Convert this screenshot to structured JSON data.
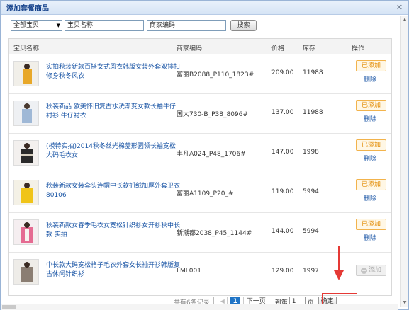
{
  "dialog": {
    "title": "添加套餐商品",
    "close_glyph": "✕"
  },
  "filters": {
    "category_select": "全部宝贝",
    "name_field": "宝贝名称",
    "code_field": "商家编码",
    "search_button": "搜索"
  },
  "table": {
    "headers": {
      "name": "宝贝名称",
      "code": "商家编码",
      "price": "价格",
      "stock": "库存",
      "action": "操作"
    },
    "rows": [
      {
        "name": "实拍秋装新款百搭女式风衣韩版女装外套双排扣修身秋冬风衣",
        "code": "富丽B2088_P110_1823#",
        "price": "209.00",
        "stock": "11988",
        "action": "已添加",
        "delete": "删除"
      },
      {
        "name": "秋装新品 欧美怀旧复古水洗渐变女款长袖牛仔衬衫 牛仔衬衣",
        "code": "国大730-B_P38_8096#",
        "price": "137.00",
        "stock": "11988",
        "action": "已添加",
        "delete": "删除"
      },
      {
        "name": "(模特实拍)2014秋冬丝光棉菱形圆领长袖宽松大码毛衣女",
        "code": "丰凡A024_P48_1706#",
        "price": "147.00",
        "stock": "1998",
        "action": "已添加",
        "delete": "删除"
      },
      {
        "name": "秋装新款女装套头连帽中长款抓绒加厚外套卫衣80106",
        "code": "富丽A1109_P20_#",
        "price": "119.00",
        "stock": "5994",
        "action": "已添加",
        "delete": "删除"
      },
      {
        "name": "秋装新款女春季毛衣女宽松针织衫女开衫秋中长款 实拍",
        "code": "新潮都2038_P45_1144#",
        "price": "144.00",
        "stock": "5994",
        "action": "已添加",
        "delete": "删除"
      },
      {
        "name": "中长款大码宽松格子毛衣外套女长袖开衫韩版复古休闲针织衫",
        "code": "LML001",
        "price": "129.00",
        "stock": "1997",
        "action": "添加",
        "delete": ""
      }
    ]
  },
  "pager": {
    "total_text": "共有6条记录",
    "prev_glyph": "◀",
    "current_page": "1",
    "next_label": "下一页",
    "goto_label": "到第",
    "page_input": "1",
    "page_unit": "页",
    "confirm_label": "确定"
  },
  "icons": {
    "add_icon": "+",
    "select_arrow": "▼",
    "scroll_up": "▲",
    "scroll_down": "▼"
  },
  "colors": {
    "link": "#1b56a6",
    "added_border": "#f2b34c",
    "added_text": "#e28a00",
    "page_active": "#1f74c6",
    "annotation_red": "#e53935"
  }
}
